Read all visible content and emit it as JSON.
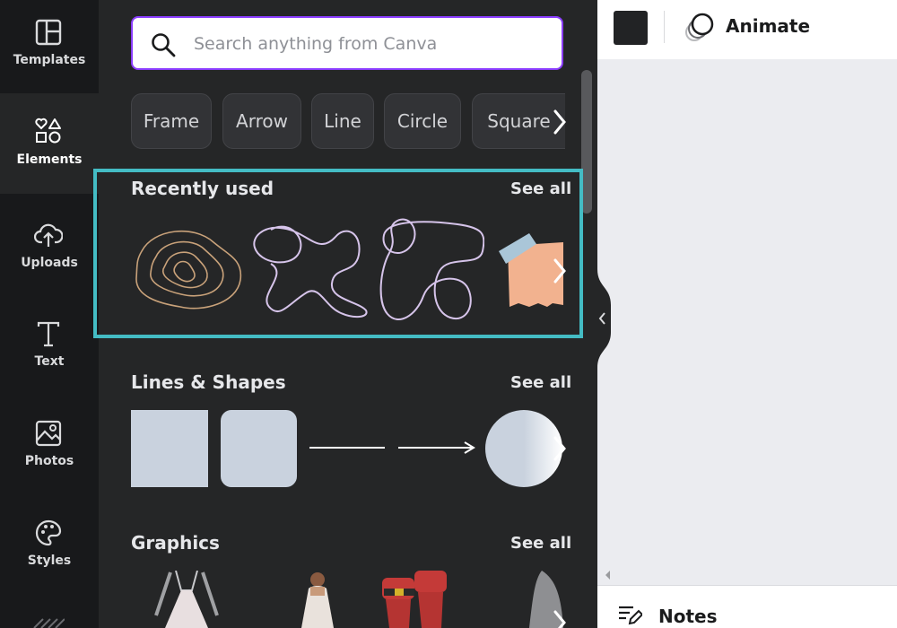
{
  "rail": {
    "items": [
      {
        "label": "Templates"
      },
      {
        "label": "Elements"
      },
      {
        "label": "Uploads"
      },
      {
        "label": "Text"
      },
      {
        "label": "Photos"
      },
      {
        "label": "Styles"
      }
    ]
  },
  "search": {
    "placeholder": "Search anything from Canva"
  },
  "chips": [
    "Frame",
    "Arrow",
    "Line",
    "Circle",
    "Square"
  ],
  "sections": {
    "recent": {
      "title": "Recently used",
      "see_all": "See all"
    },
    "lines": {
      "title": "Lines & Shapes",
      "see_all": "See all"
    },
    "graphics": {
      "title": "Graphics",
      "see_all": "See all"
    }
  },
  "toolbar": {
    "animate_label": "Animate",
    "swatch_color": "#222325"
  },
  "bottom": {
    "notes_label": "Notes"
  },
  "colors": {
    "accent": "#8b3dff",
    "highlight": "#44bcc4",
    "panel": "#252627",
    "rail": "#18191b"
  }
}
